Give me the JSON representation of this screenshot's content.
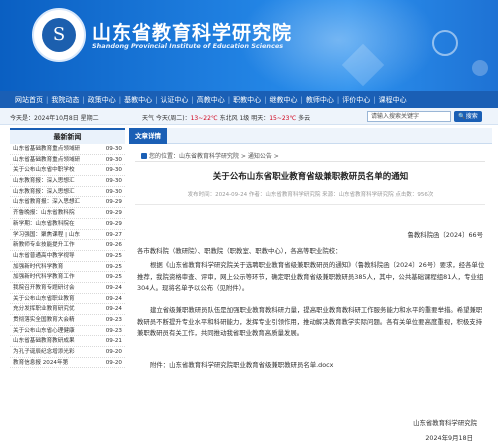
{
  "header": {
    "title": "山东省教育科学研究院",
    "subtitle": "Shandong Provincial Institute of Education Sciences",
    "logo_icon": "institute-seal-icon",
    "logo_text": "山东省教育科学研究院"
  },
  "nav": {
    "items": [
      "网站首页",
      "我院动态",
      "政策中心",
      "基教中心",
      "认证中心",
      "高教中心",
      "职教中心",
      "继教中心",
      "教师中心",
      "评价中心",
      "课程中心"
    ]
  },
  "infobar": {
    "date": "今天是：2024年10月8日 星期二",
    "weather_prefix": "天气  今天(周二)：",
    "today_temp": "13~22℃",
    "today_wind": "东北风 1级  明天：",
    "tomorrow_temp": "15~23℃",
    "tomorrow_tail": "多云",
    "search_placeholder": "请输入搜索关键字",
    "search_button": "搜索"
  },
  "sidebar": {
    "title": "最新新闻",
    "items": [
      {
        "title": "山东省基础教育重点领域研",
        "date": "09-30"
      },
      {
        "title": "山东省基础教育重点领域研",
        "date": "09-30"
      },
      {
        "title": "关于公布山东省中职学校",
        "date": "09-30"
      },
      {
        "title": "山东教育报：深入思想汇",
        "date": "09-30"
      },
      {
        "title": "山东教育报：深入思想汇",
        "date": "09-30"
      },
      {
        "title": "山东省教育报：深入思想汇",
        "date": "09-29"
      },
      {
        "title": "齐鲁晚报：山东省教科院",
        "date": "09-29"
      },
      {
        "title": "新学期：山东省教科院在",
        "date": "09-29"
      },
      {
        "title": "学习强国：聚焦课程 | 山东",
        "date": "09-27"
      },
      {
        "title": "新教师专业技能提升工作",
        "date": "09-26"
      },
      {
        "title": "山东省普通高中教学视导",
        "date": "09-25"
      },
      {
        "title": "加强新时代科学教育",
        "date": "09-25"
      },
      {
        "title": "加强新时代科学教育工作",
        "date": "09-25"
      },
      {
        "title": "我院召开教育专题研讨会",
        "date": "09-24"
      },
      {
        "title": "关于公布山东省职业教育",
        "date": "09-24"
      },
      {
        "title": "充分发挥职业教育研究优",
        "date": "09-24"
      },
      {
        "title": "贯彻落实全国教育大会精",
        "date": "09-23"
      },
      {
        "title": "关于公布山东省心理健康",
        "date": "09-23"
      },
      {
        "title": "山东省基础教育教研成果",
        "date": "09-21"
      },
      {
        "title": "为孔子诞辰纪念增添光彩",
        "date": "09-20"
      },
      {
        "title": "教育信息报 2024年第",
        "date": "09-20"
      }
    ]
  },
  "main": {
    "tab": "文章详情",
    "breadcrumb": "您的位置：山东省教育科学研究院 > 通知公告 >",
    "title": "关于公布山东省职业教育省级兼职教研员名单的通知",
    "meta": "发布时间：2024-09-24  作者：山东省教育科学研究院  来源：山东省教育科学研究院  点击数：956次",
    "doc_no": "鲁教科院函〔2024〕66号",
    "salutation": "各市教科院（教研院）、职教院（职教室、职教中心），各高等职业院校：",
    "para1": "根据《山东省教育科学研究院关于选聘职业教育省级兼职教研员的通知》（鲁教科院函〔2024〕26号）要求，经各单位推荐，我院资格审查、评审，网上公示等环节，确定职业教育省级兼职教研员385人，其中，公共基础课程组81人，专业组304人。现将名单予以公布（见附件）。",
    "para2": "建立省级兼职教研员队伍是加强职业教育教科研力量，提高职业教育教科研工作服务能力和水平的重要举措。希望兼职教研员不断提升专业水平和科研能力，发挥专业引领作用，推动解决教育教学实际问题。各有关单位要高度重视，积极支持兼职教研员有关工作，共同推动我省职业教育高质量发展。",
    "attachment": "附件：山东省教育科学研究院职业教育省级兼职教研员名单.docx",
    "signature": "山东省教育科学研究院",
    "sign_date": "2024年9月18日"
  }
}
